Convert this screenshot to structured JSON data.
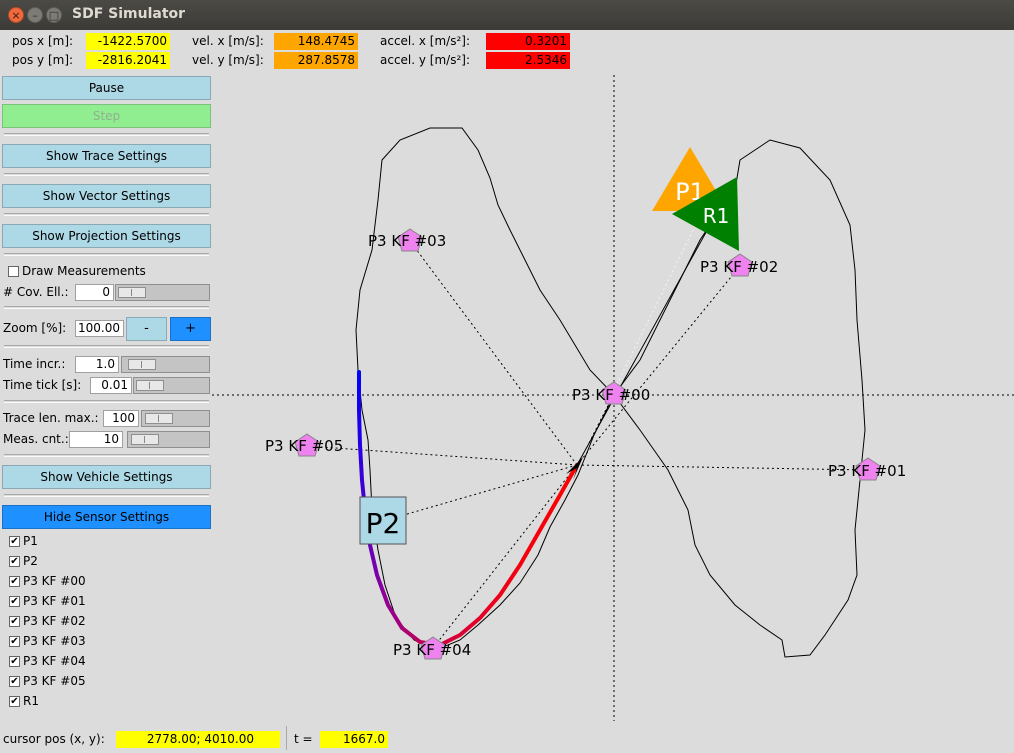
{
  "window": {
    "title": "SDF Simulator",
    "close_glyph": "×",
    "min_glyph": "–",
    "max_glyph": "□"
  },
  "readouts": {
    "pos_x": {
      "label": "pos x [m]:",
      "value": "-1422.5700"
    },
    "pos_y": {
      "label": "pos y [m]:",
      "value": "-2816.2041"
    },
    "vel_x": {
      "label": "vel. x [m/s]:",
      "value": "148.4745"
    },
    "vel_y": {
      "label": "vel. y [m/s]:",
      "value": "287.8578"
    },
    "accel_x": {
      "label": "accel. x [m/s²]:",
      "value": "0.3201"
    },
    "accel_y": {
      "label": "accel. y [m/s²]:",
      "value": "2.5346"
    },
    "colors": {
      "pos": "#ffff00",
      "vel": "#ffa500",
      "accel": "#ff0000"
    }
  },
  "sidebar": {
    "pause": "Pause",
    "step": "Step",
    "show_trace": "Show Trace Settings",
    "show_vector": "Show Vector Settings",
    "show_projection": "Show Projection Settings",
    "draw_measurements": {
      "label": "Draw Measurements",
      "checked": false
    },
    "cov_ell": {
      "label": "# Cov. Ell.:",
      "value": "0"
    },
    "zoom": {
      "label": "Zoom [%]:",
      "value": "100.00",
      "minus": "-",
      "plus": "+"
    },
    "time_incr": {
      "label": "Time incr.:",
      "value": "1.0"
    },
    "time_tick": {
      "label": "Time tick [s]:",
      "value": "0.01"
    },
    "trace_len": {
      "label": "Trace len. max.:",
      "value": "100"
    },
    "meas_cnt": {
      "label": "Meas. cnt.:",
      "value": "10"
    },
    "show_vehicle": "Show Vehicle Settings",
    "hide_sensor": "Hide Sensor Settings",
    "sensors": [
      {
        "label": "P1",
        "checked": true
      },
      {
        "label": "P2",
        "checked": true
      },
      {
        "label": "P3 KF #00",
        "checked": true
      },
      {
        "label": "P3 KF #01",
        "checked": true
      },
      {
        "label": "P3 KF #02",
        "checked": true
      },
      {
        "label": "P3 KF #03",
        "checked": true
      },
      {
        "label": "P3 KF #04",
        "checked": true
      },
      {
        "label": "P3 KF #05",
        "checked": true
      },
      {
        "label": "R1",
        "checked": true
      }
    ],
    "check_glyph": "✔"
  },
  "scene": {
    "labels": {
      "p1": "P1",
      "r1": "R1",
      "p2": "P2",
      "kf00": "P3 KF #00",
      "kf01": "P3 KF #01",
      "kf02": "P3 KF #02",
      "kf03": "P3 KF #03",
      "kf04": "P3 KF #04",
      "kf05": "P3 KF #05"
    },
    "colors": {
      "p1": "#ffa500",
      "r1": "#008000",
      "p2": "#add8e6",
      "kf": "#ee82ee",
      "trace_start": "#ff0000",
      "trace_end": "#0000ff"
    }
  },
  "status": {
    "cursor_label": "cursor pos (x, y):",
    "cursor_value": "2778.00; 4010.00",
    "t_label": "t =",
    "t_value": "1667.0"
  }
}
